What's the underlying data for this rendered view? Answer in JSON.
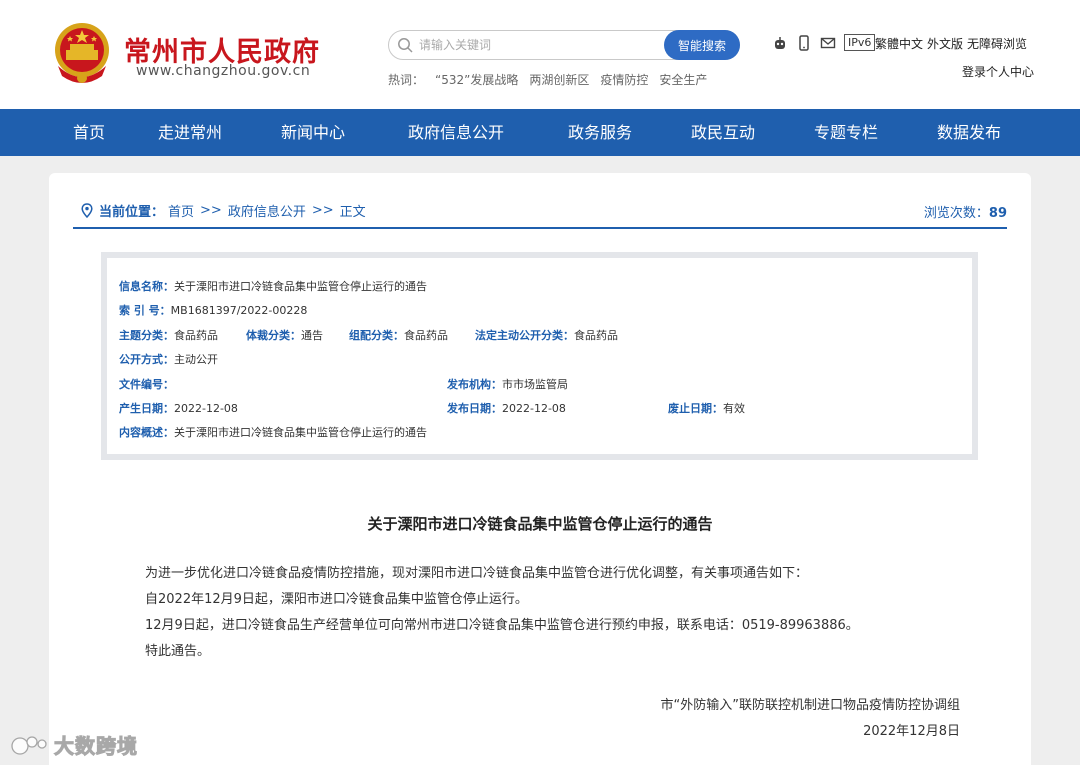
{
  "header": {
    "site_title": "常州市人民政府",
    "site_url": "www.changzhou.gov.cn",
    "search_placeholder": "请输入关键词",
    "search_button": "智能搜索",
    "hot_label": "热词：",
    "hot_words": [
      "“532”发展战略",
      "两湖创新区",
      "疫情防控",
      "安全生产"
    ],
    "ipv6": "IPv6",
    "traditional": "繁體中文",
    "foreign": "外文版",
    "accessible": "无障碍浏览",
    "login": "登录个人中心"
  },
  "nav": [
    "首页",
    "走进常州",
    "新闻中心",
    "政府信息公开",
    "政务服务",
    "政民互动",
    "专题专栏",
    "数据发布"
  ],
  "breadcrumb": {
    "label": "当前位置：",
    "items": [
      "首页",
      "政府信息公开",
      "正文"
    ],
    "separator": ">>"
  },
  "views": {
    "label": "浏览次数：",
    "count": "89"
  },
  "info": {
    "name_label": "信息名称：",
    "name": "关于溧阳市进口冷链食品集中监管仓停止运行的通告",
    "index_label": "索 引 号：",
    "index": "MB1681397/2022-00228",
    "topic_label": "主题分类：",
    "topic": "食品药品",
    "genre_label": "体裁分类：",
    "genre": "通告",
    "org_cat_label": "组配分类：",
    "org_cat": "食品药品",
    "legal_label": "法定主动公开分类：",
    "legal": "食品药品",
    "mode_label": "公开方式：",
    "mode": "主动公开",
    "doc_no_label": "文件编号：",
    "doc_no": "",
    "publisher_label": "发布机构：",
    "publisher": "市市场监管局",
    "created_label": "产生日期：",
    "created": "2022-12-08",
    "published_label": "发布日期：",
    "published": "2022-12-08",
    "expiry_label": "废止日期：",
    "expiry": "有效",
    "summary_label": "内容概述：",
    "summary": "关于溧阳市进口冷链食品集中监管仓停止运行的通告"
  },
  "article": {
    "title": "关于溧阳市进口冷链食品集中监管仓停止运行的通告",
    "paragraphs": [
      "为进一步优化进口冷链食品疫情防控措施，现对溧阳市进口冷链食品集中监管仓进行优化调整，有关事项通告如下：",
      "自2022年12月9日起，溧阳市进口冷链食品集中监管仓停止运行。",
      "12月9日起，进口冷链食品生产经营单位可向常州市进口冷链食品集中监管仓进行预约申报，联系电话：0519-89963886。",
      "特此通告。"
    ],
    "signature_org": "市“外防输入”联防联控机制进口物品疫情防控协调组",
    "signature_date": "2022年12月8日"
  },
  "watermark": "大数跨境",
  "colors": {
    "nav_bg": "#1f5fae",
    "title_red": "#c8161d",
    "search_btn": "#2e6bc4"
  }
}
